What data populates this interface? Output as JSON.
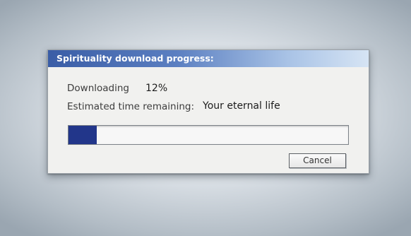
{
  "dialog": {
    "title": "Spirituality download progress:",
    "downloading_label": "Downloading",
    "downloading_value": "12%",
    "time_label": "Estimated time remaining:",
    "time_value": "Your eternal life",
    "progress_fraction": 0.1,
    "cancel_label": "Cancel"
  },
  "colors": {
    "titlebar_start": "#3a5da6",
    "titlebar_end": "#d6e4f4",
    "progress_fill": "#22368a"
  }
}
